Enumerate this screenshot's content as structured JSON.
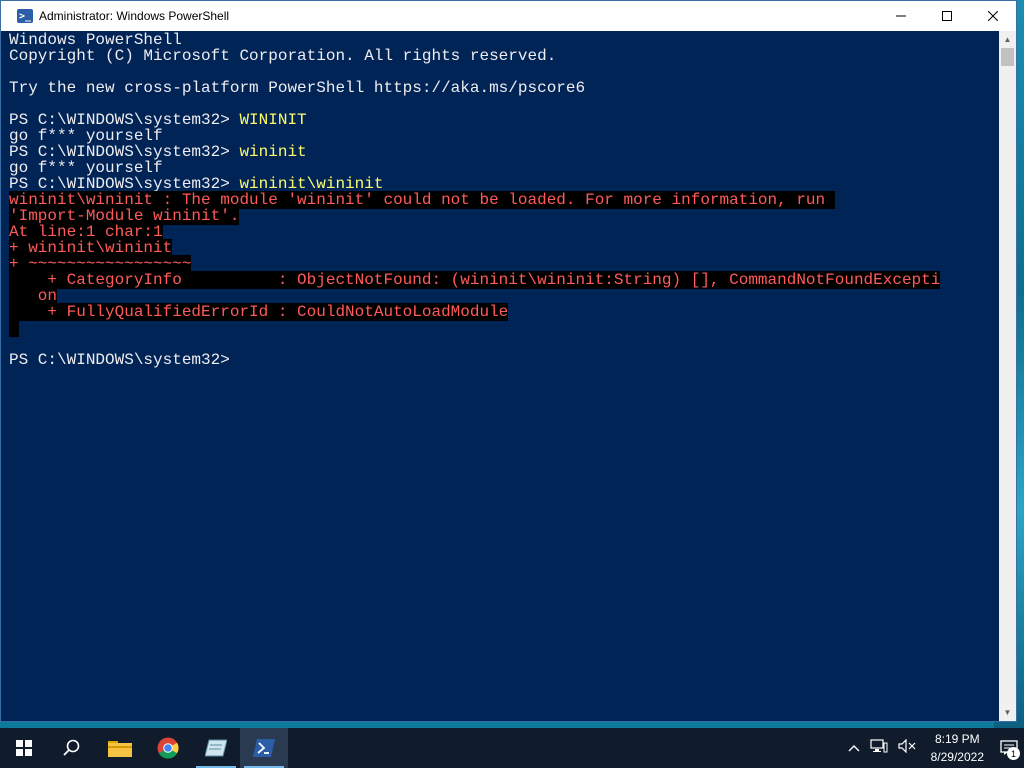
{
  "window": {
    "title": "Administrator: Windows PowerShell",
    "minimize_glyph": "—",
    "maximize_glyph": "☐",
    "close_glyph": "✕"
  },
  "console": {
    "lines": [
      {
        "text": "Windows PowerShell",
        "style": "normal"
      },
      {
        "text": "Copyright (C) Microsoft Corporation. All rights reserved.",
        "style": "normal"
      },
      {
        "text": "",
        "style": "normal"
      },
      {
        "text": "Try the new cross-platform PowerShell https://aka.ms/pscore6",
        "style": "normal"
      },
      {
        "text": "",
        "style": "normal"
      },
      {
        "prompt": "PS C:\\WINDOWS\\system32> ",
        "command": "WININIT",
        "style": "prompt"
      },
      {
        "text": "go f*** yourself",
        "style": "normal"
      },
      {
        "prompt": "PS C:\\WINDOWS\\system32> ",
        "command": "wininit",
        "style": "prompt"
      },
      {
        "text": "go f*** yourself",
        "style": "normal"
      },
      {
        "prompt": "PS C:\\WINDOWS\\system32> ",
        "command": "wininit\\wininit",
        "style": "prompt"
      },
      {
        "text": "wininit\\wininit : The module 'wininit' could not be loaded. For more information, run ",
        "style": "error"
      },
      {
        "text": "'Import-Module wininit'.",
        "style": "error"
      },
      {
        "text": "At line:1 char:1",
        "style": "error"
      },
      {
        "text": "+ wininit\\wininit",
        "style": "error"
      },
      {
        "text": "+ ~~~~~~~~~~~~~~~~~",
        "style": "error"
      },
      {
        "text": "    + CategoryInfo          : ObjectNotFound: (wininit\\wininit:String) [], CommandNotFoundExcepti",
        "style": "error"
      },
      {
        "text": "   on",
        "style": "error"
      },
      {
        "text": "    + FullyQualifiedErrorId : CouldNotAutoLoadModule",
        "style": "error"
      },
      {
        "text": " ",
        "style": "error"
      },
      {
        "text": "",
        "style": "normal"
      },
      {
        "prompt": "PS C:\\WINDOWS\\system32> ",
        "command": "",
        "style": "prompt"
      }
    ]
  },
  "taskbar": {
    "items": [
      {
        "name": "start-button",
        "icon": "windows-logo-icon"
      },
      {
        "name": "search-button",
        "icon": "search-icon"
      },
      {
        "name": "file-explorer",
        "icon": "folder-icon"
      },
      {
        "name": "chrome",
        "icon": "chrome-icon"
      },
      {
        "name": "notepad-app",
        "icon": "notepad-icon"
      },
      {
        "name": "powershell-app",
        "icon": "powershell-icon"
      }
    ],
    "clock_time": "8:19 PM",
    "clock_date": "8/29/2022",
    "notification_count": "1"
  },
  "colors": {
    "console_bg": "#012456",
    "console_fg": "#eeedf0",
    "error_fg": "#ff5a5a",
    "command_fg": "#fefb6b"
  }
}
